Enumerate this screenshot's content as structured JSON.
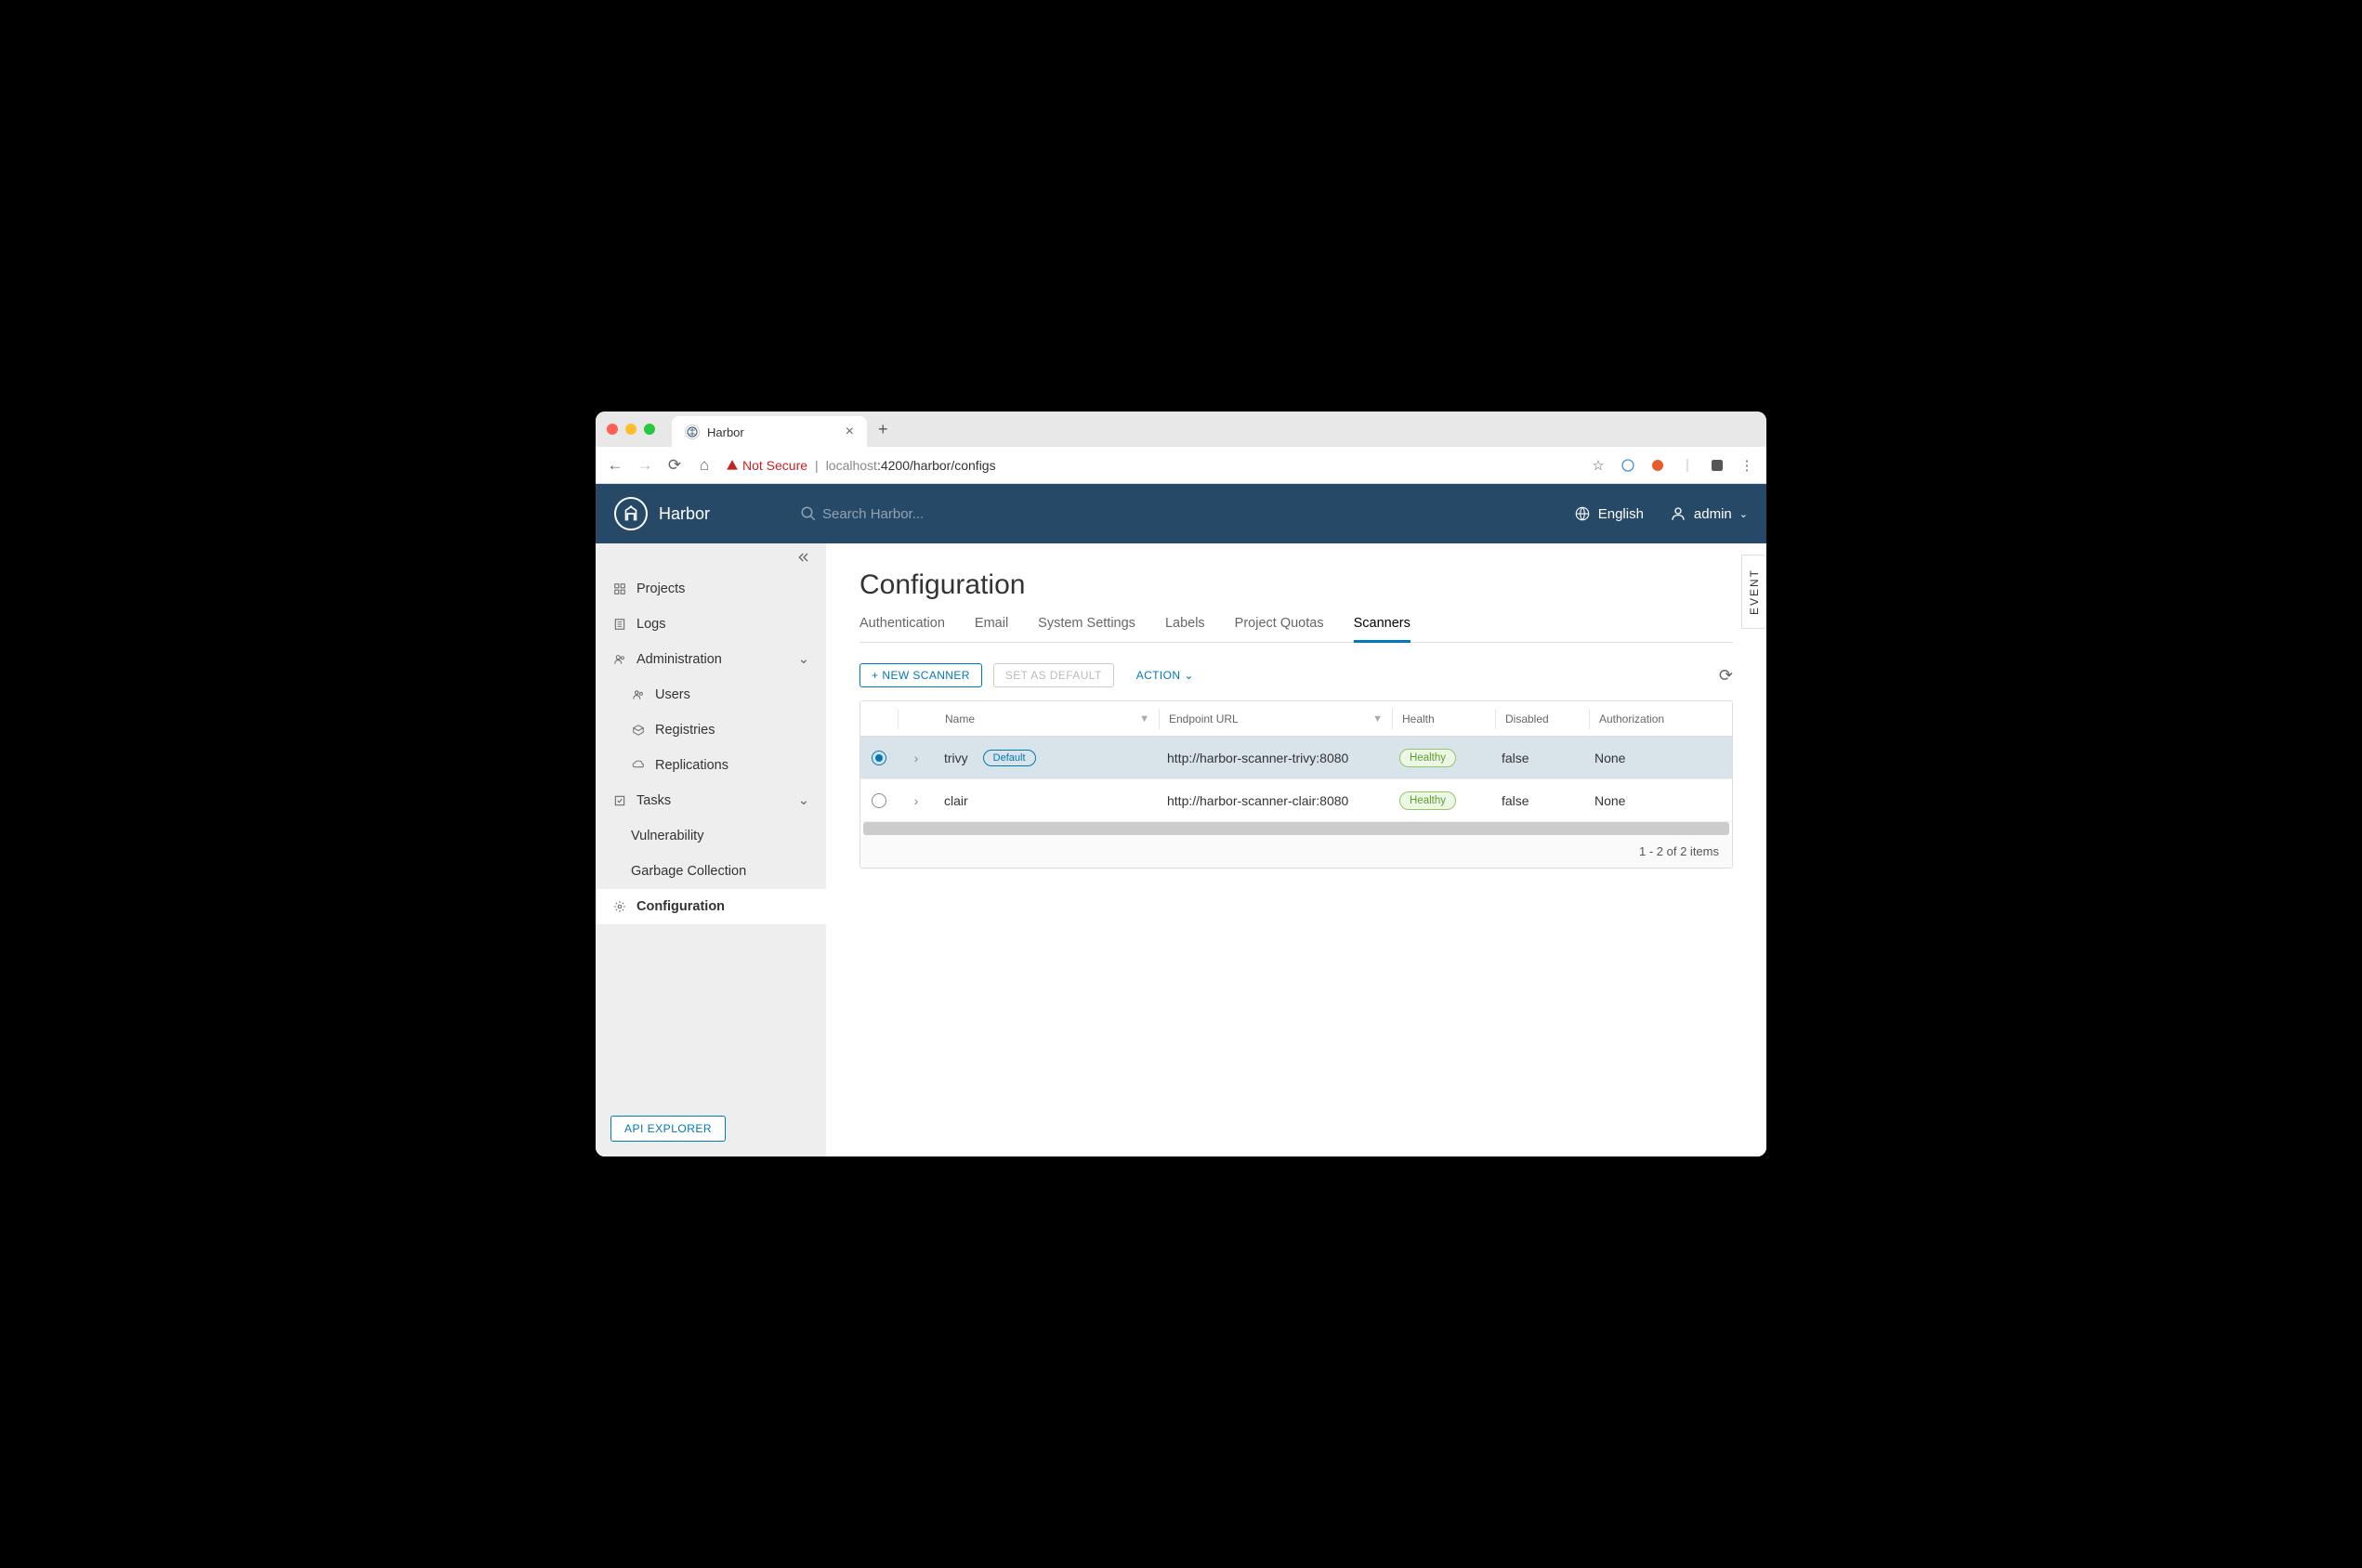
{
  "browser": {
    "tab_title": "Harbor",
    "not_secure": "Not Secure",
    "url_host": "localhost",
    "url_port_path": ":4200/harbor/configs"
  },
  "header": {
    "brand": "Harbor",
    "search_placeholder": "Search Harbor...",
    "language": "English",
    "user": "admin"
  },
  "sidebar": {
    "projects": "Projects",
    "logs": "Logs",
    "administration": "Administration",
    "users": "Users",
    "registries": "Registries",
    "replications": "Replications",
    "tasks": "Tasks",
    "vulnerability": "Vulnerability",
    "garbage": "Garbage Collection",
    "configuration": "Configuration",
    "api_explorer": "API EXPLORER"
  },
  "page": {
    "title": "Configuration",
    "tabs": {
      "auth": "Authentication",
      "email": "Email",
      "system": "System Settings",
      "labels": "Labels",
      "quotas": "Project Quotas",
      "scanners": "Scanners"
    },
    "new_scanner": "NEW SCANNER",
    "set_default": "SET AS DEFAULT",
    "action": "ACTION",
    "event_tab": "EVENT"
  },
  "table": {
    "headers": {
      "name": "Name",
      "endpoint": "Endpoint URL",
      "health": "Health",
      "disabled": "Disabled",
      "auth": "Authorization"
    },
    "default_badge": "Default",
    "healthy_badge": "Healthy",
    "rows": [
      {
        "name": "trivy",
        "url": "http://harbor-scanner-trivy:8080",
        "disabled": "false",
        "auth": "None",
        "selected": true,
        "default": true
      },
      {
        "name": "clair",
        "url": "http://harbor-scanner-clair:8080",
        "disabled": "false",
        "auth": "None",
        "selected": false,
        "default": false
      }
    ],
    "pagination": "1 - 2 of 2 items"
  }
}
